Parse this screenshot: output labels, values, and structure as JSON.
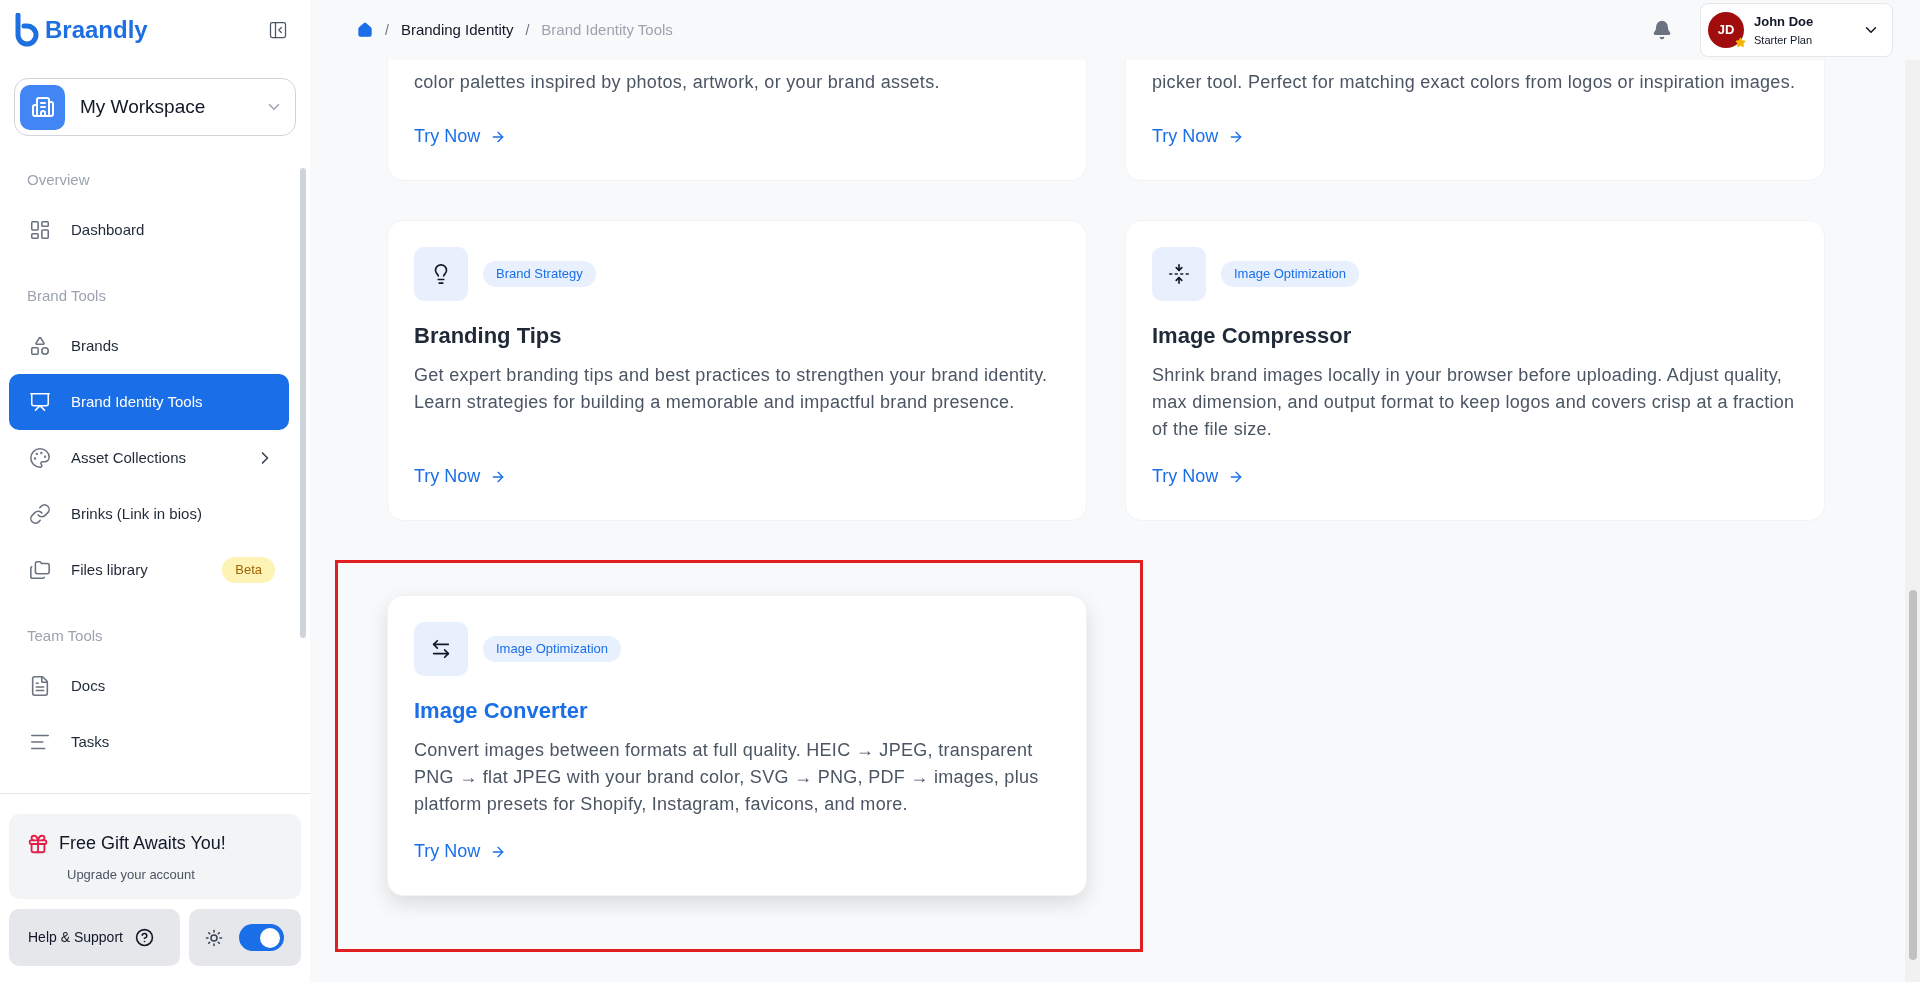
{
  "sidebar": {
    "brand": "Braandly",
    "workspace": "My Workspace",
    "sections": [
      {
        "label": "Overview",
        "items": [
          {
            "label": "Dashboard",
            "selected": false
          }
        ]
      },
      {
        "label": "Brand Tools",
        "items": [
          {
            "label": "Brands",
            "selected": false
          },
          {
            "label": "Brand Identity Tools",
            "selected": true
          },
          {
            "label": "Asset Collections",
            "selected": false,
            "expanded": false
          },
          {
            "label": "Brinks (Link in bios)",
            "selected": false
          },
          {
            "label": "Files library",
            "selected": false,
            "badge": "Beta"
          }
        ]
      },
      {
        "label": "Team Tools",
        "items": [
          {
            "label": "Docs",
            "selected": false
          },
          {
            "label": "Tasks",
            "selected": false
          }
        ]
      }
    ],
    "promo": {
      "title": "Free Gift Awaits You!",
      "subtitle": "Upgrade your account"
    },
    "help": "Help & Support",
    "theme_toggle": {
      "on": true
    }
  },
  "header": {
    "breadcrumb": [
      {
        "separator": "/",
        "label": "Branding Identity"
      },
      {
        "separator": "/",
        "label": "Brand Identity Tools"
      }
    ],
    "user": {
      "initials": "JD",
      "name": "John Doe",
      "plan": "Starter Plan"
    }
  },
  "partial_cards": [
    {
      "description": "color palettes inspired by photos, artwork, or your brand assets.",
      "action": "Try Now"
    },
    {
      "description": "picker tool. Perfect for matching exact colors from logos or inspiration images.",
      "action": "Try Now"
    }
  ],
  "tools": [
    {
      "tag": "Brand Strategy",
      "title": "Branding Tips",
      "description": "Get expert branding tips and best practices to strengthen your brand identity. Learn strategies for building a memorable and impactful brand presence.",
      "action": "Try Now",
      "highlighted": false
    },
    {
      "tag": "Image Optimization",
      "title": "Image Compressor",
      "description": "Shrink brand images locally in your browser before uploading. Adjust quality, max dimension, and output format to keep logos and covers crisp at a fraction of the file size.",
      "action": "Try Now",
      "highlighted": false
    },
    {
      "tag": "Image Optimization",
      "title": "Image Converter",
      "description": "Convert images between formats at full quality. HEIC → JPEG, transparent PNG → flat JPEG with your brand color, SVG → PNG, PDF → images, plus platform presets for Shopify, Instagram, favicons, and more.",
      "action": "Try Now",
      "highlighted": true
    }
  ]
}
